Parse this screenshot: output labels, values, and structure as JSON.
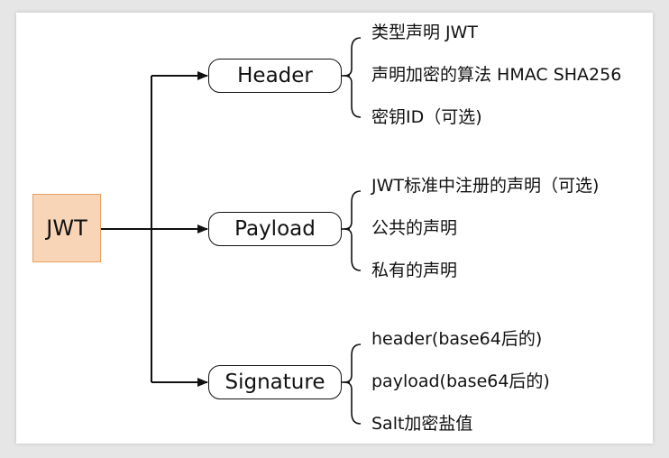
{
  "root": {
    "label": "JWT"
  },
  "branches": [
    {
      "label": "Header",
      "items": [
        "类型声明 JWT",
        "声明加密的算法 HMAC SHA256",
        "密钥ID（可选)"
      ]
    },
    {
      "label": "Payload",
      "items": [
        "JWT标准中注册的声明（可选)",
        "公共的声明",
        "私有的声明"
      ]
    },
    {
      "label": "Signature",
      "items": [
        "header(base64后的)",
        "payload(base64后的)",
        "Salt加密盐值"
      ]
    }
  ],
  "colors": {
    "root_fill": "#f9d5b7",
    "root_border": "#e8a063",
    "line": "#111111"
  }
}
